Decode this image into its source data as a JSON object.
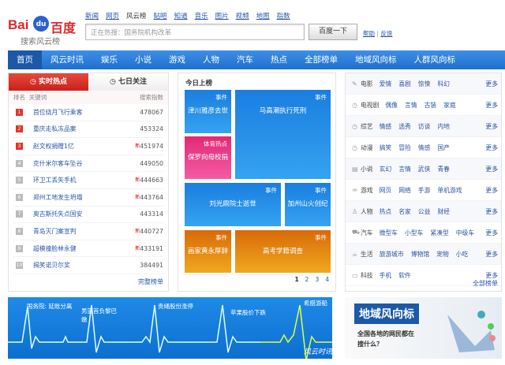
{
  "logo": {
    "text": "Bai du 百度",
    "subtitle": "搜索风云榜"
  },
  "top_links": [
    "新闻",
    "网页",
    "风云榜",
    "贴吧",
    "知道",
    "音乐",
    "图片",
    "视频",
    "地图",
    "指数"
  ],
  "top_links_current": 2,
  "search": {
    "placeholder": "正在热搜：国务院机构改革",
    "button": "百度一下"
  },
  "help": {
    "help": "帮助",
    "sep": "|",
    "feedback": "反馈"
  },
  "nav": [
    "首页",
    "风云时讯",
    "娱乐",
    "小说",
    "游戏",
    "人物",
    "汽车",
    "热点",
    "全部榜单",
    "地域风向标",
    "人群风向标"
  ],
  "hot": {
    "tabs": [
      "实时热点",
      "七日关注"
    ],
    "headers": {
      "rank": "排名",
      "keyword": "关键词",
      "index": "搜索指数"
    },
    "rows": [
      {
        "rank": "1",
        "kw": "首位绕月飞行乘客",
        "val": "478067",
        "new": ""
      },
      {
        "rank": "2",
        "kw": "重庆走私冻品案",
        "val": "453324",
        "new": ""
      },
      {
        "rank": "3",
        "kw": "赵文权捐赠1亿",
        "val": "451974",
        "new": "新"
      },
      {
        "rank": "4",
        "kw": "克什米尔客车坠谷",
        "val": "449050",
        "new": ""
      },
      {
        "rank": "5",
        "kw": "环卫工丢失手机",
        "val": "444663",
        "new": "新"
      },
      {
        "rank": "6",
        "kw": "郑州工地发生坍塌",
        "val": "443764",
        "new": "新"
      },
      {
        "rank": "7",
        "kw": "奥古斯托失点国安",
        "val": "443314",
        "new": ""
      },
      {
        "rank": "8",
        "kw": "青岛灭门案宣判",
        "val": "440727",
        "new": "新"
      },
      {
        "rank": "9",
        "kw": "超模撞脸林永健",
        "val": "433191",
        "new": "新"
      },
      {
        "rank": "10",
        "kw": "揭笑诺贝尔奖",
        "val": "384491",
        "new": ""
      }
    ],
    "more": "完整榜单"
  },
  "today": {
    "title": "今日上榜",
    "tiles": [
      {
        "cat": "事件",
        "title": "津川雅彦去世"
      },
      {
        "cat": "事件",
        "title": "马高潮执行死刑"
      },
      {
        "cat": "体育热点",
        "title": "保罗向母校捐"
      },
      {
        "cat": "事件",
        "title": "刘光鼎院士逝世"
      },
      {
        "cat": "事件",
        "title": "加州山火创纪"
      },
      {
        "cat": "事件",
        "title": "画家黄永厚辞"
      },
      {
        "cat": "事件",
        "title": "高考学籍调查"
      }
    ],
    "pages": [
      "1",
      "2",
      "3",
      "4"
    ]
  },
  "categories": [
    {
      "icon": "✎",
      "name": "电影",
      "tags": [
        "爱情",
        "喜剧",
        "惊悚",
        "科幻"
      ]
    },
    {
      "icon": "◷",
      "name": "电视剧",
      "tags": [
        "偶像",
        "言情",
        "古装",
        "家庭"
      ]
    },
    {
      "icon": "◷",
      "name": "综艺",
      "tags": [
        "情感",
        "选秀",
        "访谈",
        "内地"
      ]
    },
    {
      "icon": "◷",
      "name": "动漫",
      "tags": [
        "搞笑",
        "冒险",
        "情感",
        "国产"
      ]
    },
    {
      "icon": "▤",
      "name": "小说",
      "tags": [
        "玄幻",
        "言情",
        "武侠",
        "青春"
      ]
    },
    {
      "icon": "♒",
      "name": "游戏",
      "tags": [
        "网页",
        "网络",
        "手游",
        "单机游戏"
      ]
    },
    {
      "icon": "♙",
      "name": "人物",
      "tags": [
        "热点",
        "名家",
        "公益",
        "财经"
      ]
    },
    {
      "icon": "⛟",
      "name": "汽车",
      "tags": [
        "微型车",
        "小型车",
        "紧凑型",
        "中级车"
      ]
    },
    {
      "icon": "☕",
      "name": "生活",
      "tags": [
        "旅游城市",
        "博物馆",
        "宠物",
        "小吃"
      ]
    },
    {
      "icon": "▭",
      "name": "科技",
      "tags": [
        "手机",
        "软件"
      ]
    }
  ],
  "categories_more": "更多",
  "categories_all": "全部榜单",
  "banner1": {
    "labels": [
      "国务院: 延账分离",
      "男篮首负黎巴嫩",
      "贵绳股份涨停",
      "苹果股价下跌",
      "希腊游船"
    ],
    "brand": "风云时讯"
  },
  "banner2": {
    "title": "地域风向标",
    "text": "全国各地的网民都在搜什么？"
  }
}
